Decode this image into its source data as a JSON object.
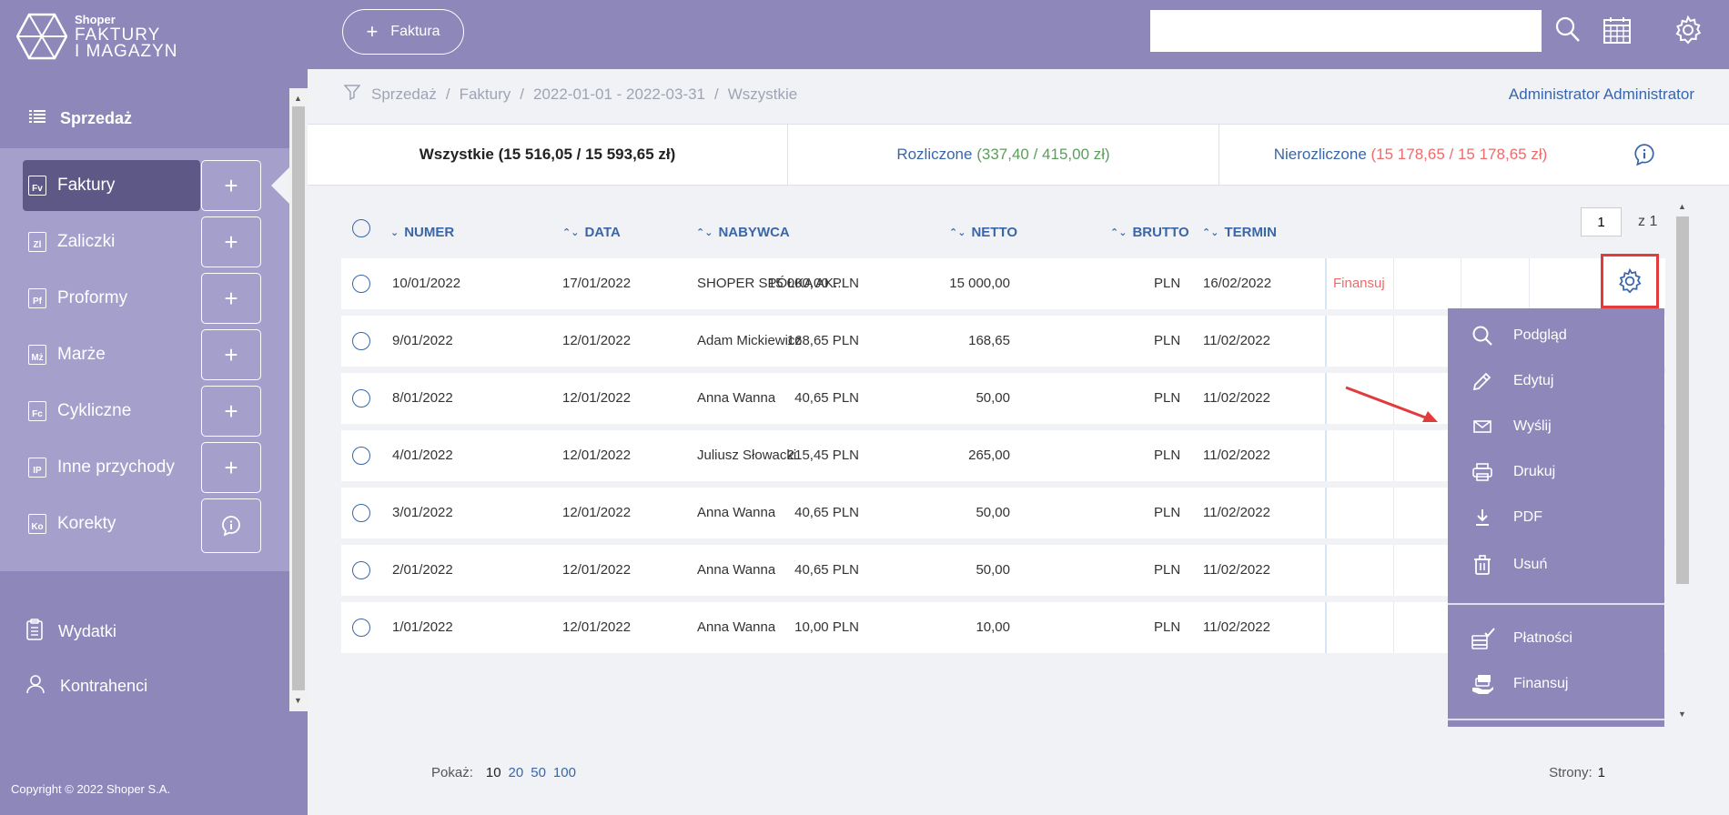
{
  "logo": {
    "small": "Shoper",
    "line1": "FAKTURY",
    "line2": "I MAGAZYN"
  },
  "sidebar": {
    "section_title": "Sprzedaż",
    "items": [
      {
        "label": "Faktury",
        "icon": "Fv",
        "action": "+"
      },
      {
        "label": "Zaliczki",
        "icon": "Zl",
        "action": "+"
      },
      {
        "label": "Proformy",
        "icon": "Pf",
        "action": "+"
      },
      {
        "label": "Marże",
        "icon": "Mż",
        "action": "+"
      },
      {
        "label": "Cykliczne",
        "icon": "Fc",
        "action": "+"
      },
      {
        "label": "Inne przychody",
        "icon": "IP",
        "action": "+"
      },
      {
        "label": "Korekty",
        "icon": "Ko",
        "action": "info"
      }
    ],
    "bottom": {
      "expenses": "Wydatki",
      "contractors": "Kontrahenci"
    },
    "copyright": "Copyright © 2022 Shoper S.A."
  },
  "header": {
    "new_button": "Faktura",
    "plus": "+"
  },
  "breadcrumb": [
    "Sprzedaż",
    "Faktury",
    "2022-01-01 - 2022-03-31",
    "Wszystkie"
  ],
  "breadcrumb_sep": "/",
  "user": "Administrator Administrator",
  "tabs": {
    "all": "Wszystkie (15 516,05 / 15 593,65 zł)",
    "settled_label": "Rozliczone",
    "settled_values": "(337,40 / 415,00 zł)",
    "unsettled_label": "Nierozliczone",
    "unsettled_values": "(15 178,65 / 15 178,65 zł)"
  },
  "pager": {
    "current": "1",
    "of": "z 1"
  },
  "columns": {
    "numer": "NUMER",
    "data": "DATA",
    "nabywca": "NABYWCA",
    "netto": "NETTO",
    "brutto": "BRUTTO",
    "termin": "TERMIN"
  },
  "currency": "PLN",
  "rows": [
    {
      "numer": "10/01/2022",
      "data": "17/01/2022",
      "nabywca": "SHOPER SPÓŁKA AK...",
      "netto": "15 000,00 PLN",
      "brutto": "15 000,00",
      "termin": "16/02/2022",
      "status": "red",
      "finansuj": "Finansuj"
    },
    {
      "numer": "9/01/2022",
      "data": "12/01/2022",
      "nabywca": "Adam Mickiewicz",
      "netto": "168,65 PLN",
      "brutto": "168,65",
      "termin": "11/02/2022",
      "status": "red"
    },
    {
      "numer": "8/01/2022",
      "data": "12/01/2022",
      "nabywca": "Anna Wanna",
      "netto": "40,65 PLN",
      "brutto": "50,00",
      "termin": "11/02/2022",
      "status": "green"
    },
    {
      "numer": "4/01/2022",
      "data": "12/01/2022",
      "nabywca": "Juliusz Słowacki",
      "netto": "215,45 PLN",
      "brutto": "265,00",
      "termin": "11/02/2022",
      "status": "green"
    },
    {
      "numer": "3/01/2022",
      "data": "12/01/2022",
      "nabywca": "Anna Wanna",
      "netto": "40,65 PLN",
      "brutto": "50,00",
      "termin": "11/02/2022",
      "status": "green"
    },
    {
      "numer": "2/01/2022",
      "data": "12/01/2022",
      "nabywca": "Anna Wanna",
      "netto": "40,65 PLN",
      "brutto": "50,00",
      "termin": "11/02/2022",
      "status": "green"
    },
    {
      "numer": "1/01/2022",
      "data": "12/01/2022",
      "nabywca": "Anna Wanna",
      "netto": "10,00 PLN",
      "brutto": "10,00",
      "termin": "11/02/2022",
      "status": "red"
    }
  ],
  "menu": {
    "preview": "Podgląd",
    "edit": "Edytuj",
    "send": "Wyślij",
    "print": "Drukuj",
    "pdf": "PDF",
    "delete": "Usuń",
    "payments": "Płatności",
    "finance": "Finansuj"
  },
  "footer": {
    "show_label": "Pokaż:",
    "show_current": "10",
    "show_options": [
      "20",
      "50",
      "100"
    ],
    "pages_label": "Strony:",
    "pages_value": "1"
  },
  "colors": {
    "primary": "#8d87ba",
    "submenu": "#a49fcb",
    "active": "#5d5886",
    "link": "#3a66a8",
    "green": "#5b9e5b",
    "red": "#ee6b6b",
    "highlight": "#e13b3b"
  }
}
